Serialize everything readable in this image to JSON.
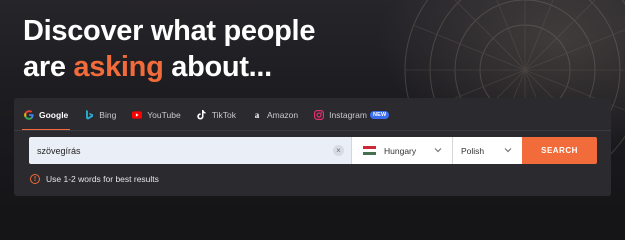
{
  "hero": {
    "line1": "Discover what people",
    "line2_prefix": "are ",
    "line2_accent": "asking",
    "line2_suffix": " about..."
  },
  "colors": {
    "accent": "#f26b3a",
    "panel": "#2b2b2f",
    "badge": "#3b6df0"
  },
  "tabs": [
    {
      "label": "Google",
      "icon": "google-icon",
      "active": true
    },
    {
      "label": "Bing",
      "icon": "bing-icon",
      "active": false
    },
    {
      "label": "YouTube",
      "icon": "youtube-icon",
      "active": false
    },
    {
      "label": "TikTok",
      "icon": "tiktok-icon",
      "active": false
    },
    {
      "label": "Amazon",
      "icon": "amazon-icon",
      "active": false
    },
    {
      "label": "Instagram",
      "icon": "instagram-icon",
      "active": false,
      "badge": "NEW"
    }
  ],
  "search": {
    "value": "szövegírás",
    "clear_icon": "close-icon",
    "country": "Hungary",
    "country_flag": "hungary-flag-icon",
    "language": "Polish",
    "button": "SEARCH"
  },
  "hint": {
    "icon": "warning-icon",
    "text": "Use 1-2 words for best results"
  }
}
